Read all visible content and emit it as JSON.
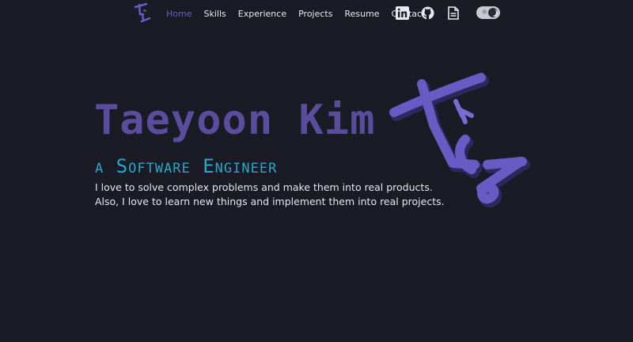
{
  "nav": {
    "logo_icon": "ty-signature-logo",
    "links": [
      {
        "label": "Home",
        "active": true
      },
      {
        "label": "Skills",
        "active": false
      },
      {
        "label": "Experience",
        "active": false
      },
      {
        "label": "Projects",
        "active": false
      },
      {
        "label": "Resume",
        "active": false
      },
      {
        "label": "Contact",
        "active": false
      }
    ],
    "social": [
      {
        "name": "linkedin-icon"
      },
      {
        "name": "github-icon"
      },
      {
        "name": "resume-document-icon"
      }
    ],
    "theme_toggle": {
      "mode": "dark",
      "icons": [
        "sun-icon",
        "moon-icon"
      ]
    }
  },
  "hero": {
    "name": "Taeyoon Kim",
    "subtitle": "a Software Engineer",
    "description_line1": "I love to solve complex problems and make them into real products.",
    "description_line2": "Also, I love to learn new things and implement them into real projects.",
    "logo_icon": "ty-signature-logo-3d"
  },
  "colors": {
    "background": "#1b1b25",
    "accent_purple": "#6a5bc4",
    "name_purple": "#5a4d9e",
    "subtitle_cyan": "#2aa6c6",
    "text": "#e6e6ef"
  }
}
